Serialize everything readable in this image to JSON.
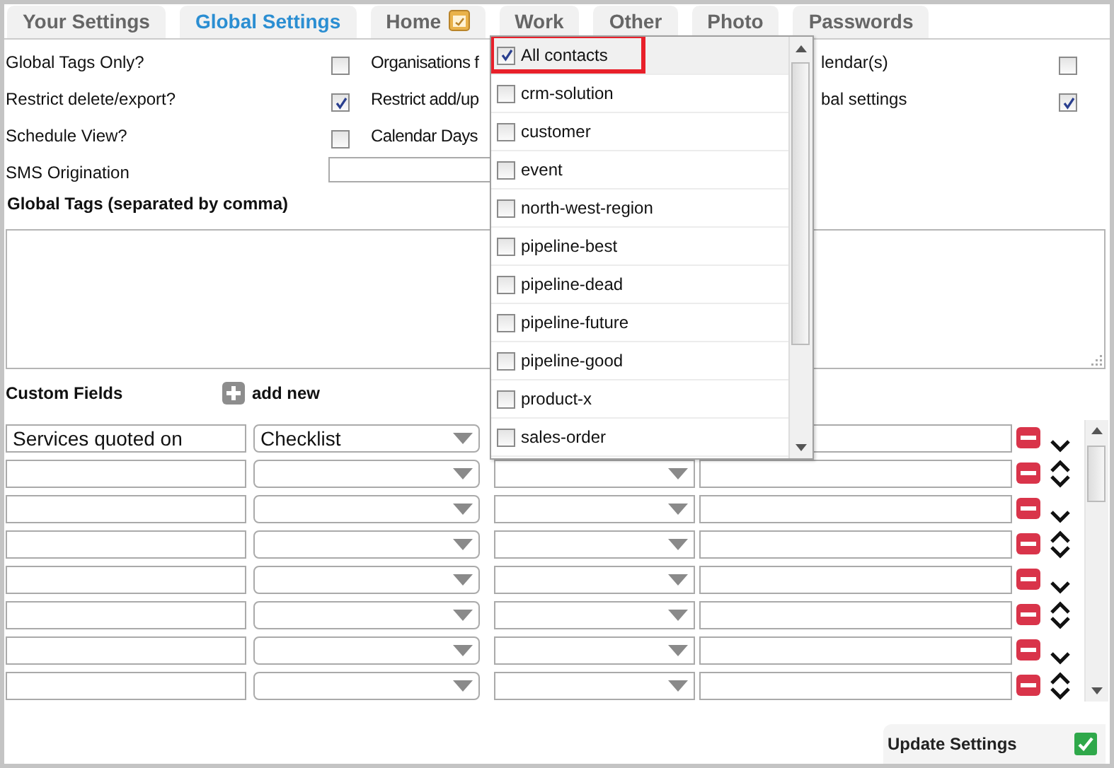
{
  "tabs": [
    {
      "label": "Your Settings",
      "selected": false,
      "kind": "text"
    },
    {
      "label": "Global Settings",
      "selected": true,
      "kind": "text"
    },
    {
      "label": "Home",
      "selected": false,
      "kind": "with-icon"
    },
    {
      "label": "Work",
      "selected": false,
      "kind": "text"
    },
    {
      "label": "Other",
      "selected": false,
      "kind": "text"
    },
    {
      "label": "Photo",
      "selected": false,
      "kind": "text"
    },
    {
      "label": "Passwords",
      "selected": false,
      "kind": "text"
    }
  ],
  "settings": [
    {
      "left": {
        "label": "Global Tags Only?",
        "checked": false
      },
      "middle": "Organisations f",
      "right": {
        "label": "lendar(s)",
        "checked": false
      }
    },
    {
      "left": {
        "label": "Restrict delete/export?",
        "checked": true
      },
      "middle": "Restrict add/up",
      "right": {
        "label": "bal settings",
        "checked": true
      }
    },
    {
      "left": {
        "label": "Schedule View?",
        "checked": false
      },
      "middle": "Calendar Days"
    }
  ],
  "sms_field": {
    "label": "SMS Origination"
  },
  "global_tags": {
    "label": "Global Tags (separated by comma)"
  },
  "custom_fields": {
    "title": "Custom Fields",
    "add_label": "add new",
    "rows": [
      {
        "name": "Services quoted on",
        "type": "Checklist",
        "can_move_up": false
      },
      {
        "can_move_up": true
      },
      {
        "can_move_up": false
      },
      {
        "can_move_up": true
      },
      {
        "can_move_up": false
      },
      {
        "can_move_up": true
      },
      {
        "can_move_up": false
      },
      {
        "can_move_up": true
      }
    ]
  },
  "dropdown": {
    "items": [
      {
        "label": "All contacts",
        "checked": true,
        "selected": true,
        "marked": true
      },
      {
        "label": "crm-solution",
        "checked": false,
        "selected": false,
        "marked": false
      },
      {
        "label": "customer",
        "checked": false,
        "selected": false,
        "marked": false
      },
      {
        "label": "event",
        "checked": false,
        "selected": false,
        "marked": false
      },
      {
        "label": "north-west-region",
        "checked": false,
        "selected": false,
        "marked": false
      },
      {
        "label": "pipeline-best",
        "checked": false,
        "selected": false,
        "marked": false
      },
      {
        "label": "pipeline-dead",
        "checked": false,
        "selected": false,
        "marked": false
      },
      {
        "label": "pipeline-future",
        "checked": false,
        "selected": false,
        "marked": false
      },
      {
        "label": "pipeline-good",
        "checked": false,
        "selected": false,
        "marked": false
      },
      {
        "label": "product-x",
        "checked": false,
        "selected": false,
        "marked": false
      },
      {
        "label": "sales-order",
        "checked": false,
        "selected": false,
        "marked": false
      }
    ]
  },
  "update_button": {
    "label": "Update Settings"
  }
}
